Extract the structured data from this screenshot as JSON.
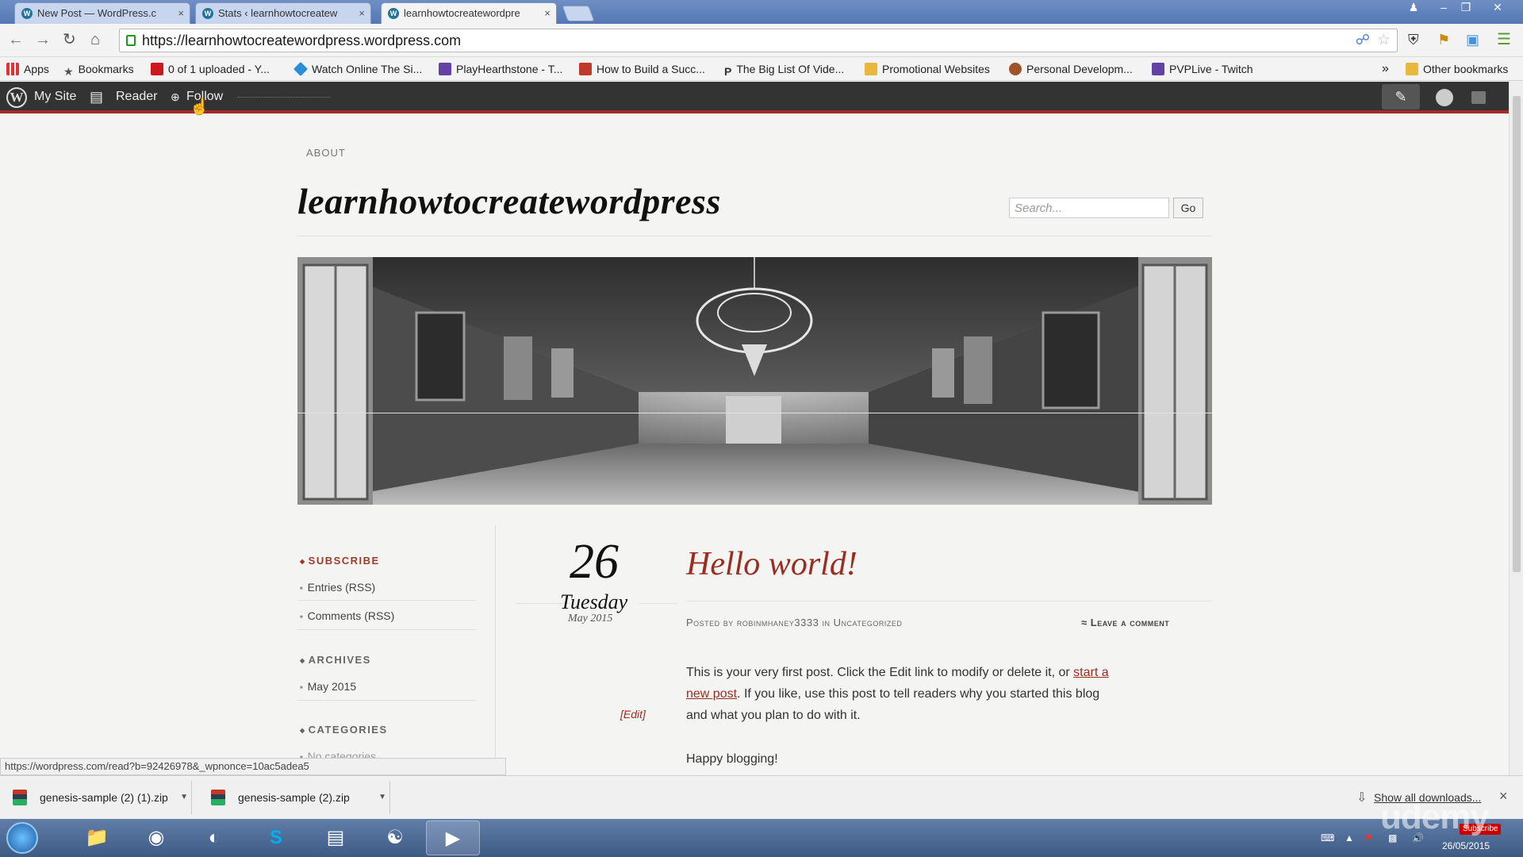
{
  "browser": {
    "tabs": [
      {
        "label": "New Post — WordPress.c"
      },
      {
        "label": "Stats ‹ learnhowtocreatew"
      },
      {
        "label": "learnhowtocreatewordpre"
      }
    ],
    "close_glyph": "×",
    "url": "https://learnhowtocreatewordpress.wordpress.com",
    "bookmarks": [
      {
        "label": "Apps",
        "icon": "apps-icon",
        "color": "#d33"
      },
      {
        "label": "Bookmarks",
        "icon": "star-icon",
        "color": "#555"
      },
      {
        "label": "0 of 1 uploaded - Y...",
        "icon": "youtube-icon",
        "color": "#cc181e"
      },
      {
        "label": "Watch Online The Si...",
        "icon": "box-icon",
        "color": "#2a8fd8"
      },
      {
        "label": "PlayHearthstone - T...",
        "icon": "twitch-icon",
        "color": "#6441a5"
      },
      {
        "label": "How to Build a Succ...",
        "icon": "page-icon",
        "color": "#c0392b"
      },
      {
        "label": "The Big List Of Vide...",
        "icon": "pinterest-icon",
        "color": "#333"
      },
      {
        "label": "Promotional Websites",
        "icon": "folder-icon",
        "color": "#e8b73d"
      },
      {
        "label": "Personal Developm...",
        "icon": "person-icon",
        "color": "#a0522d"
      },
      {
        "label": "PVPLive - Twitch",
        "icon": "twitch-icon",
        "color": "#6441a5"
      }
    ],
    "more_bookmarks": "»",
    "other_bookmarks": "Other bookmarks"
  },
  "adminbar": {
    "my_site": "My Site",
    "reader": "Reader",
    "follow": "Follow"
  },
  "site": {
    "nav_about": "ABOUT",
    "title": "learnhowtocreatewordpress",
    "search_placeholder": "Search...",
    "go": "Go"
  },
  "sidebar": {
    "subscribe": "SUBSCRIBE",
    "subscribe_items": [
      "Entries (RSS)",
      "Comments (RSS)"
    ],
    "archives": "ARCHIVES",
    "archive_items": [
      "May 2015"
    ],
    "categories": "CATEGORIES",
    "category_items": [
      "No categories"
    ]
  },
  "post": {
    "day": "26",
    "weekday": "Tuesday",
    "month_year": "May 2015",
    "title": "Hello world!",
    "posted_by": "Posted by",
    "author": "robinmhaney3333",
    "in": "in",
    "category": "Uncategorized",
    "leave_comment": "Leave a comment",
    "body_1a": "This is your very first post. Click the Edit link to modify or delete it, or ",
    "body_1_link": "start a",
    "body_2_link": "new post",
    "body_2a": ". If you like, use this post to tell readers why you started this blog",
    "body_3": "and what you plan to do with it.",
    "body_4": "Happy blogging!",
    "edit": "[Edit]"
  },
  "status_url": "https://wordpress.com/read?b=92426978&_wpnonce=10ac5adea5",
  "downloads": {
    "items": [
      "genesis-sample (2) (1).zip",
      "genesis-sample (2).zip"
    ],
    "show_all": "Show all downloads...",
    "close": "×"
  },
  "taskbar": {
    "clock_date": "26/05/2015",
    "subscribe_badge": "Subscribe",
    "watermark": "udemy"
  }
}
